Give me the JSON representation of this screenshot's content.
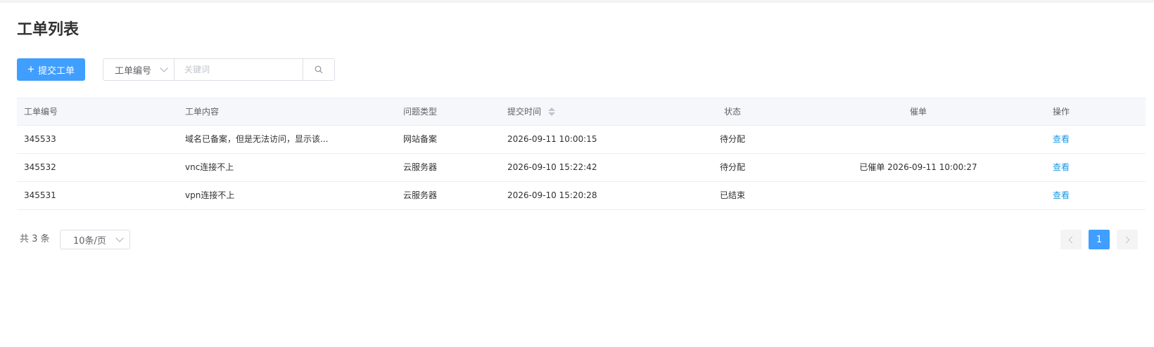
{
  "page": {
    "title": "工单列表"
  },
  "toolbar": {
    "submit_label": "提交工单",
    "search_field_selected": "工单编号",
    "keyword_placeholder": "关键词",
    "keyword_value": ""
  },
  "table": {
    "headers": {
      "id": "工单编号",
      "content": "工单内容",
      "type": "问题类型",
      "time": "提交时间",
      "status": "状态",
      "urge": "催单",
      "action": "操作"
    },
    "rows": [
      {
        "id": "345533",
        "content": "域名已备案，但是无法访问，显示该...",
        "type": "网站备案",
        "time": "2026-09-11 10:00:15",
        "status": "待分配",
        "urge": "",
        "action": "查看"
      },
      {
        "id": "345532",
        "content": "vnc连接不上",
        "type": "云服务器",
        "time": "2026-09-10 15:22:42",
        "status": "待分配",
        "urge": "已催单 2026-09-11 10:00:27",
        "action": "查看"
      },
      {
        "id": "345531",
        "content": "vpn连接不上",
        "type": "云服务器",
        "time": "2026-09-10 15:20:28",
        "status": "已结束",
        "urge": "",
        "action": "查看"
      }
    ]
  },
  "pagination": {
    "total_text": "共 3 条",
    "page_size": "10条/页",
    "current_page": "1"
  },
  "colors": {
    "primary": "#409eff",
    "link": "#1a9ae8",
    "header_bg": "#f5f7fa",
    "border": "#ebeef5"
  }
}
